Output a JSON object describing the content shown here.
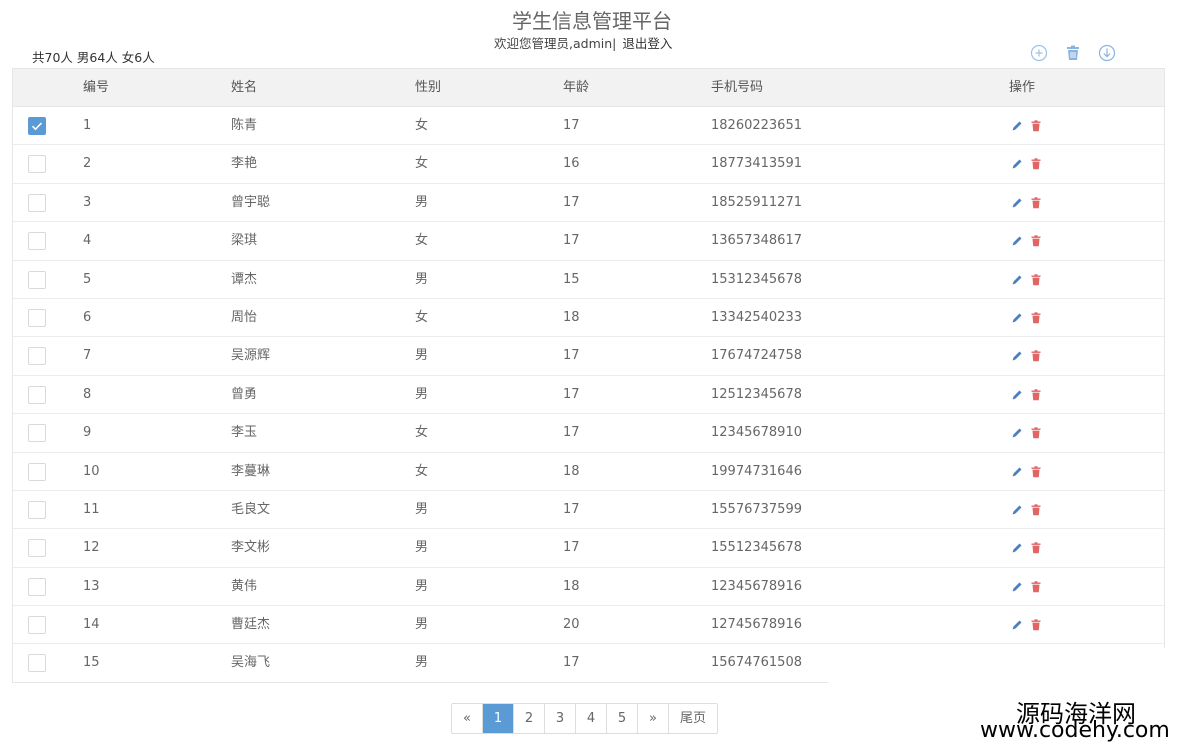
{
  "header": {
    "title": "学生信息管理平台",
    "welcome": "欢迎您管理员,admin|",
    "logout": "退出登入",
    "stats": "共70人 男64人 女6人"
  },
  "toolbar": {
    "icons": [
      "plus-circle-icon",
      "trash-icon",
      "download-icon"
    ],
    "icon_color": "#8ab4e0"
  },
  "table": {
    "columns": [
      "编号",
      "姓名",
      "性别",
      "年龄",
      "手机号码",
      "操作"
    ],
    "rows": [
      {
        "id": "1",
        "name": "陈青",
        "sex": "女",
        "age": "17",
        "phone": "18260223651",
        "checked": true
      },
      {
        "id": "2",
        "name": "李艳",
        "sex": "女",
        "age": "16",
        "phone": "18773413591",
        "checked": false
      },
      {
        "id": "3",
        "name": "曾宇聪",
        "sex": "男",
        "age": "17",
        "phone": "18525911271",
        "checked": false
      },
      {
        "id": "4",
        "name": "梁琪",
        "sex": "女",
        "age": "17",
        "phone": "13657348617",
        "checked": false
      },
      {
        "id": "5",
        "name": "谭杰",
        "sex": "男",
        "age": "15",
        "phone": "15312345678",
        "checked": false
      },
      {
        "id": "6",
        "name": "周怡",
        "sex": "女",
        "age": "18",
        "phone": "13342540233",
        "checked": false
      },
      {
        "id": "7",
        "name": "吴源辉",
        "sex": "男",
        "age": "17",
        "phone": "17674724758",
        "checked": false
      },
      {
        "id": "8",
        "name": "曾勇",
        "sex": "男",
        "age": "17",
        "phone": "12512345678",
        "checked": false
      },
      {
        "id": "9",
        "name": "李玉",
        "sex": "女",
        "age": "17",
        "phone": "12345678910",
        "checked": false
      },
      {
        "id": "10",
        "name": "李蔓琳",
        "sex": "女",
        "age": "18",
        "phone": "19974731646",
        "checked": false
      },
      {
        "id": "11",
        "name": "毛良文",
        "sex": "男",
        "age": "17",
        "phone": "15576737599",
        "checked": false
      },
      {
        "id": "12",
        "name": "李文彬",
        "sex": "男",
        "age": "17",
        "phone": "15512345678",
        "checked": false
      },
      {
        "id": "13",
        "name": "黄伟",
        "sex": "男",
        "age": "18",
        "phone": "12345678916",
        "checked": false
      },
      {
        "id": "14",
        "name": "曹廷杰",
        "sex": "男",
        "age": "20",
        "phone": "12745678916",
        "checked": false
      },
      {
        "id": "15",
        "name": "吴海飞",
        "sex": "男",
        "age": "17",
        "phone": "15674761508",
        "checked": false
      }
    ],
    "edit_icon_color": "#4a7fc1",
    "delete_icon_color": "#e06666",
    "checkbox_color": "#5b9bd5"
  },
  "pagination": {
    "prev": "«",
    "pages": [
      "1",
      "2",
      "3",
      "4",
      "5"
    ],
    "current": "1",
    "next": "»",
    "last": "尾页"
  },
  "watermark": {
    "line1": "源码海洋网",
    "line2": "www.codehy.com"
  }
}
